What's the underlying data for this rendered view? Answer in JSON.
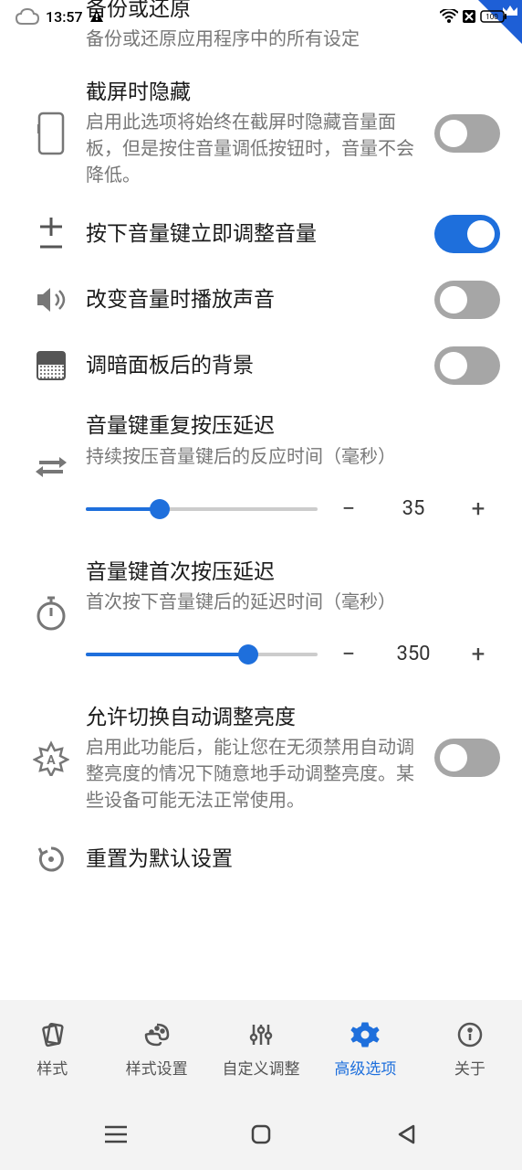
{
  "status": {
    "time": "13:57"
  },
  "settings": {
    "backup": {
      "title": "备份或还原",
      "desc": "备份或还原应用程序中的所有设定"
    },
    "hide_on_screenshot": {
      "title": "截屏时隐藏",
      "desc": "启用此选项将始终在截屏时隐藏音量面板，但是按住音量调低按钮时，音量不会降低。",
      "on": false
    },
    "immediate_volume": {
      "title": "按下音量键立即调整音量",
      "on": true
    },
    "play_sound": {
      "title": "改变音量时播放声音",
      "on": false
    },
    "dim_background": {
      "title": "调暗面板后的背景",
      "on": false
    },
    "repeat_delay": {
      "title": "音量键重复按压延迟",
      "desc": "持续按压音量键后的反应时间（毫秒）",
      "value": "35",
      "pct": 32
    },
    "first_delay": {
      "title": "音量键首次按压延迟",
      "desc": "首次按下音量键后的延迟时间（毫秒）",
      "value": "350",
      "pct": 70
    },
    "auto_brightness": {
      "title": "允许切换自动调整亮度",
      "desc": "启用此功能后，能让您在无须禁用自动调整亮度的情况下随意地手动调整亮度。某些设备可能无法正常使用。",
      "on": false
    },
    "reset": {
      "title": "重置为默认设置"
    }
  },
  "nav": {
    "style": "样式",
    "style_settings": "样式设置",
    "custom": "自定义调整",
    "advanced": "高级选项",
    "about": "关于"
  },
  "labels": {
    "minus": "−",
    "plus": "+"
  }
}
